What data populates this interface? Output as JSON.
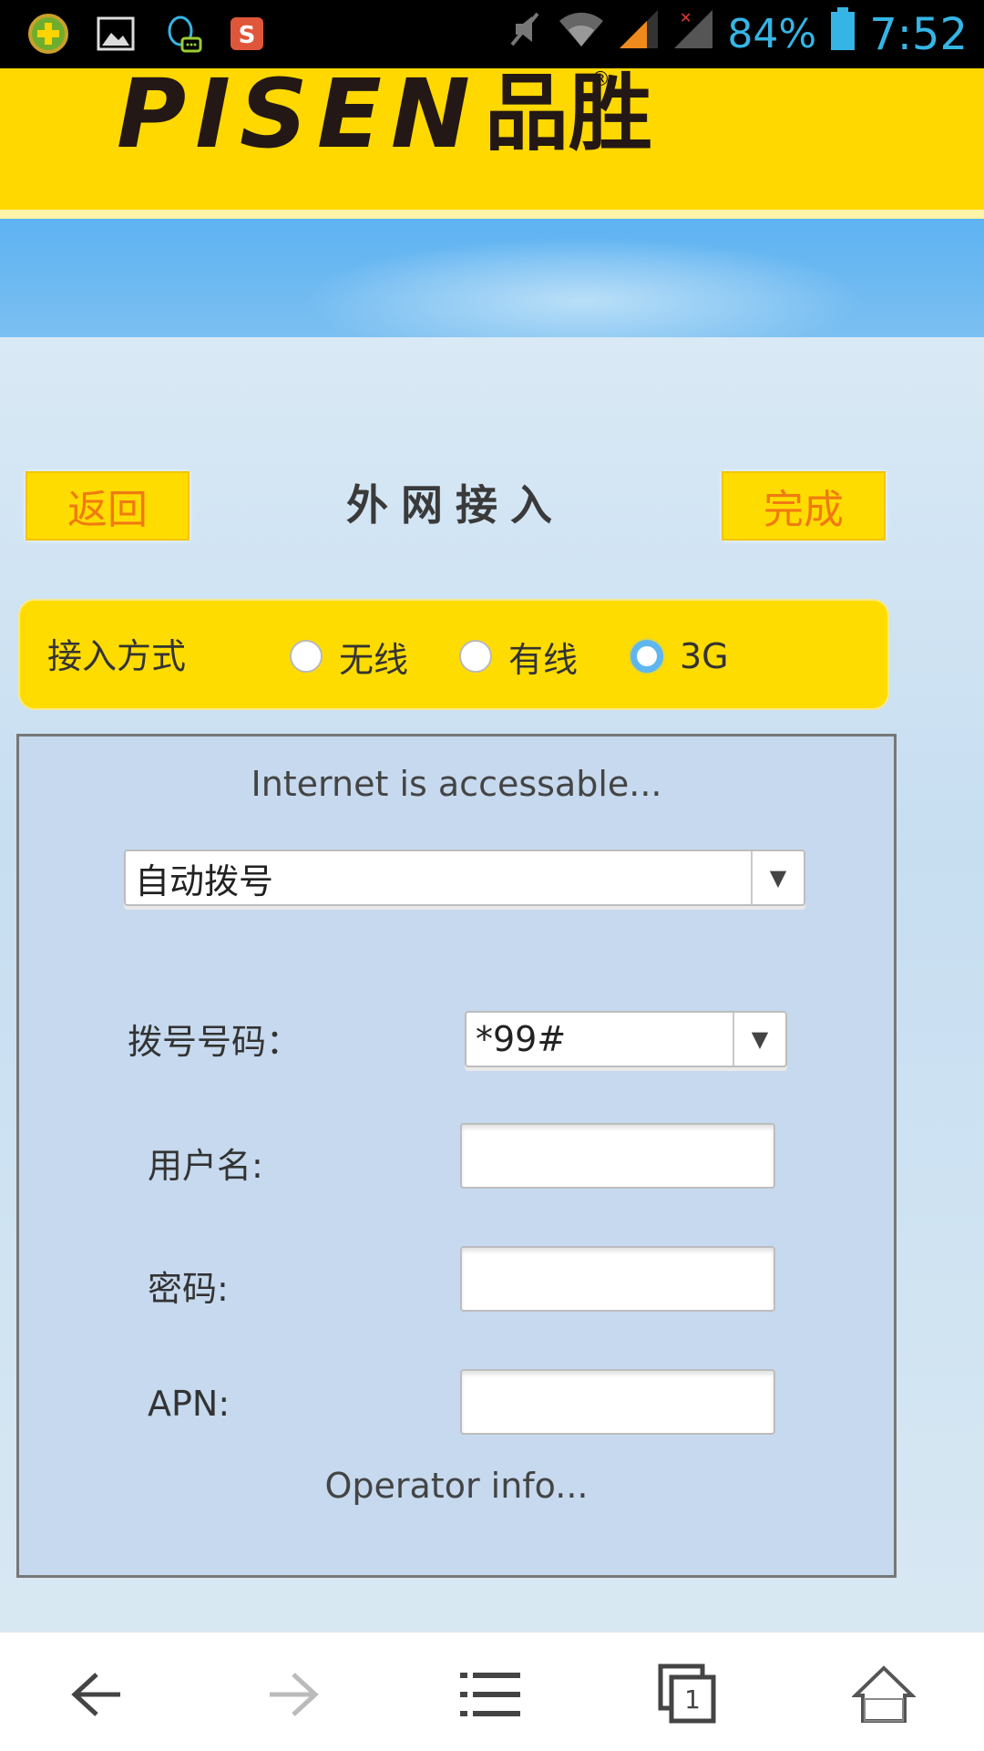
{
  "status_bar": {
    "battery_percent": "84%",
    "time": "7:52",
    "icons": [
      "app-green-icon",
      "gallery-icon",
      "qq-icon",
      "sogou-input-icon",
      "mute-icon",
      "wifi-icon",
      "signal-icon",
      "signal-no-sim-icon",
      "battery-icon"
    ]
  },
  "header": {
    "logo_text": "PISEN",
    "logo_cn": "品胜",
    "logo_reg": "®"
  },
  "toolbar": {
    "back_label": "返回",
    "title": "外网接入",
    "done_label": "完成"
  },
  "access_mode": {
    "label": "接入方式",
    "options": [
      {
        "label": "无线",
        "checked": false
      },
      {
        "label": "有线",
        "checked": false
      },
      {
        "label": "3G",
        "checked": true
      }
    ]
  },
  "form": {
    "status": "Internet is accessable...",
    "dial_mode": {
      "selected": "自动拨号"
    },
    "dial_number": {
      "label": "拨号号码：",
      "selected": "*99#"
    },
    "username": {
      "label": "用户名:",
      "value": ""
    },
    "password": {
      "label": "密码:",
      "value": ""
    },
    "apn": {
      "label": "APN:",
      "value": ""
    },
    "operator_info": "Operator info..."
  },
  "browser_nav": {
    "tab_count": "1",
    "items": [
      "back-icon",
      "forward-icon",
      "menu-icon",
      "tabs-icon",
      "home-icon"
    ]
  },
  "colors": {
    "brand_yellow": "#ffd800",
    "button_text": "#f07a12",
    "radio_selected": "#5fb6ef",
    "status_accent": "#35b5e5"
  }
}
